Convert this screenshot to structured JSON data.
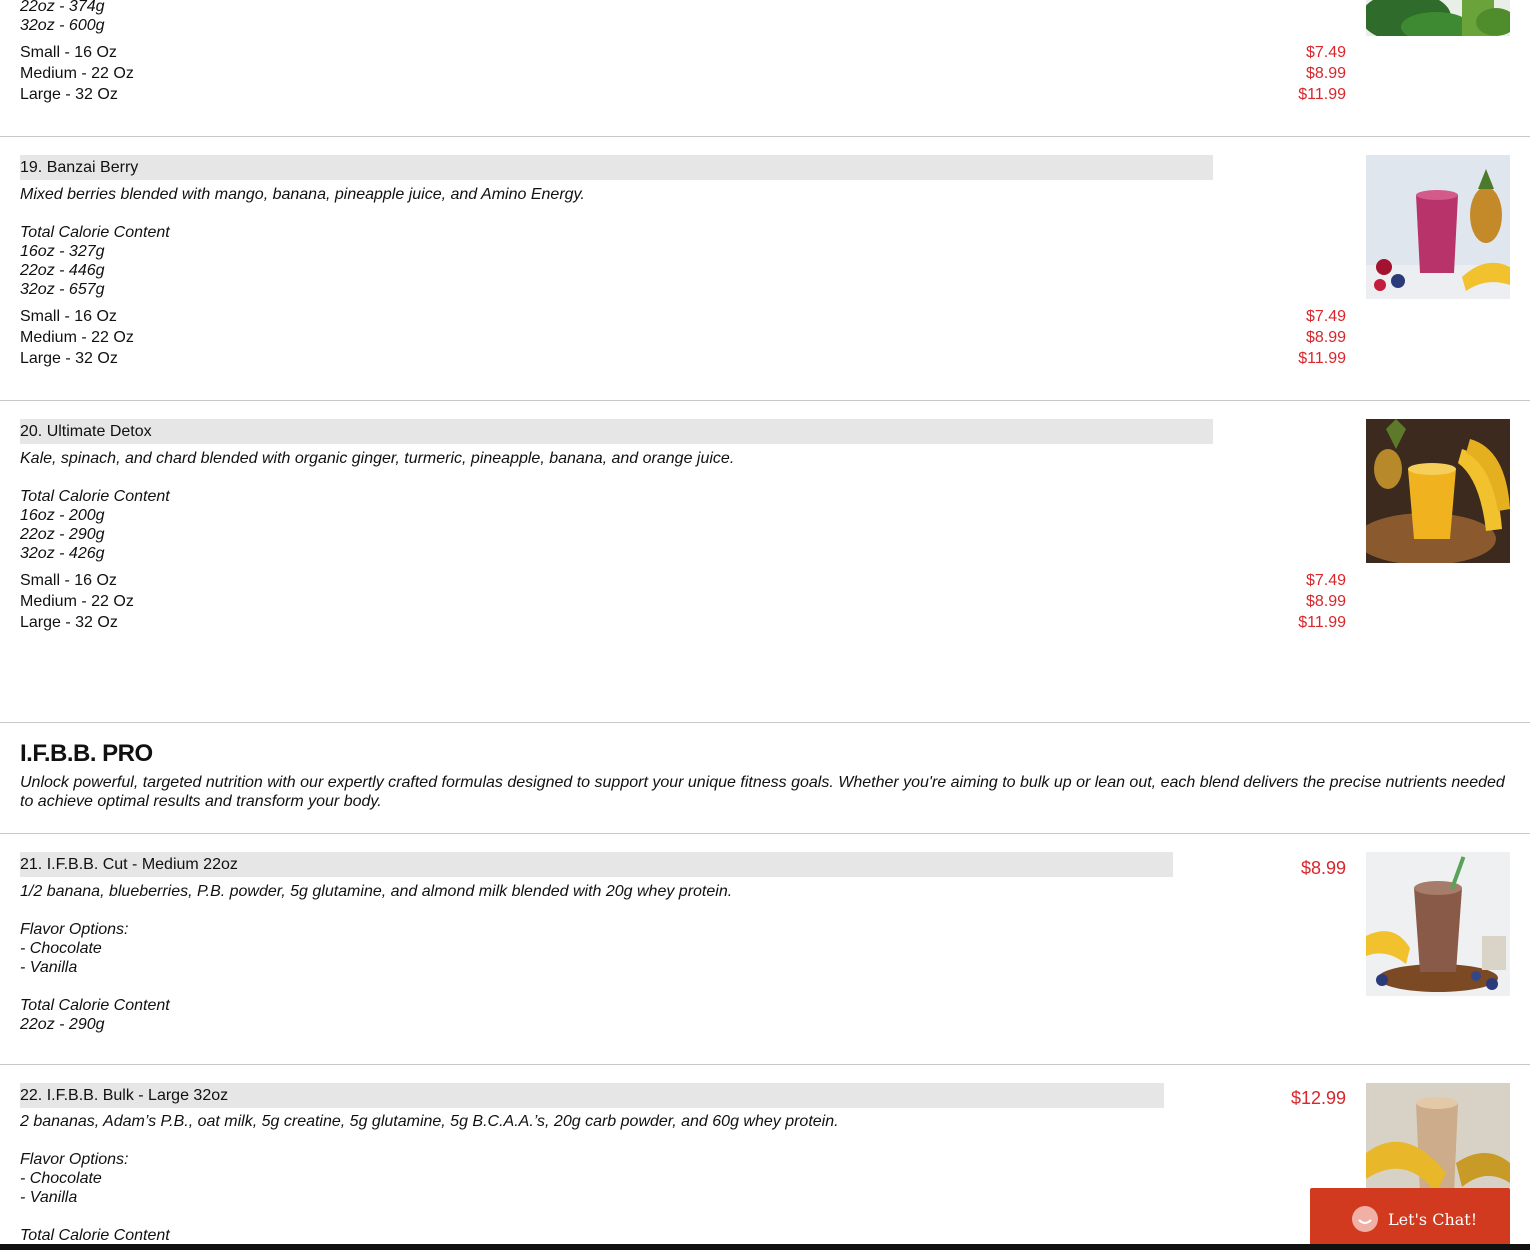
{
  "top_item": {
    "calories": [
      "22oz - 374g",
      "32oz - 600g"
    ],
    "sizes": [
      "Small - 16 Oz",
      "Medium - 22 Oz",
      "Large - 32 Oz"
    ],
    "prices": [
      "$7.49",
      "$8.99",
      "$11.99"
    ]
  },
  "item19": {
    "title": "19. Banzai Berry",
    "description": "Mixed berries blended with mango, banana, pineapple juice, and Amino Energy.",
    "calorie_heading": "Total Calorie Content",
    "calories": [
      "16oz - 327g",
      "22oz - 446g",
      "32oz - 657g"
    ],
    "sizes": [
      "Small - 16 Oz",
      "Medium - 22 Oz",
      "Large - 32 Oz"
    ],
    "prices": [
      "$7.49",
      "$8.99",
      "$11.99"
    ]
  },
  "item20": {
    "title": "20. Ultimate Detox",
    "description": "Kale, spinach, and chard blended with organic ginger, turmeric, pineapple, banana, and orange juice.",
    "calorie_heading": "Total Calorie Content",
    "calories": [
      "16oz - 200g",
      "22oz - 290g",
      "32oz - 426g"
    ],
    "sizes": [
      "Small - 16 Oz",
      "Medium - 22 Oz",
      "Large - 32 Oz"
    ],
    "prices": [
      "$7.49",
      "$8.99",
      "$11.99"
    ]
  },
  "section": {
    "title": "I.F.B.B. PRO",
    "description": "Unlock powerful, targeted nutrition with our expertly crafted formulas designed to support your unique fitness goals. Whether you're aiming to bulk up or lean out, each blend delivers the precise nutrients needed to achieve optimal results and transform your body."
  },
  "item21": {
    "title": "21. I.F.B.B. Cut - Medium 22oz",
    "price": "$8.99",
    "description": "1/2 banana, blueberries, P.B. powder, 5g glutamine, and almond milk blended with 20g whey protein.",
    "flavor_heading": "Flavor Options:",
    "flavors": [
      "- Chocolate",
      "- Vanilla"
    ],
    "calorie_heading": "Total Calorie Content",
    "calories": [
      "22oz - 290g"
    ]
  },
  "item22": {
    "title": "22. I.F.B.B. Bulk - Large 32oz",
    "price": "$12.99",
    "description": "2 bananas, Adam’s P.B., oat milk, 5g creatine, 5g glutamine, 5g B.C.A.A.’s, 20g carb powder, and 60g whey protein.",
    "flavor_heading": "Flavor Options:",
    "flavors": [
      "- Chocolate",
      "- Vanilla"
    ],
    "calorie_heading": "Total Calorie Content"
  },
  "chat": {
    "label": "Let's Chat!"
  },
  "colors": {
    "price": "#d8262b",
    "title_bar": "#e6e6e6",
    "chat": "#d13a1f"
  }
}
